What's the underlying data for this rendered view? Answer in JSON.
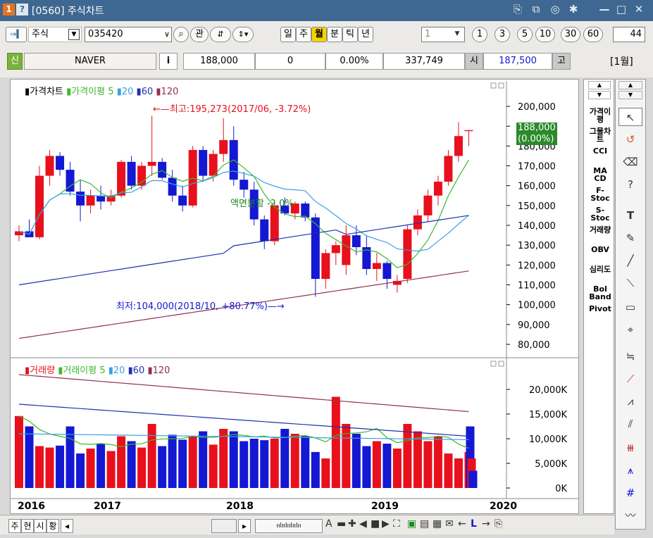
{
  "titlebar": {
    "num": "1",
    "help": "?",
    "title": "[0560] 주식차트",
    "icons": [
      "pin-icon",
      "copy-icon",
      "camera-icon",
      "settings-icon",
      "minimize-icon",
      "maximize-icon",
      "close-icon"
    ],
    "glyphs": [
      "⎘",
      "⧉",
      "◎",
      "✱",
      "—",
      "□",
      "✕"
    ]
  },
  "toolbar": {
    "arrow": "⇒▍",
    "market": "주식",
    "code": "035420",
    "rel": "관",
    "periods": [
      "일",
      "주",
      "월",
      "분",
      "틱",
      "년"
    ],
    "active_period": "월",
    "count": "1",
    "nums": [
      "1",
      "3",
      "5",
      "10",
      "30",
      "60"
    ],
    "right_value": "44",
    "sin": "신",
    "name": "NAVER",
    "info": "i",
    "price": "188,000",
    "change": "0",
    "rate": "0.00%",
    "volume": "337,749",
    "open_label": "시",
    "open_value": "187,500",
    "high_label": "고",
    "interval": "[1월]"
  },
  "price_chart": {
    "legend": [
      "가격차트",
      "가격이평",
      "5",
      "20",
      "60",
      "120"
    ],
    "yticks": [
      "200,000",
      "190,000",
      "180,000",
      "170,000",
      "160,000",
      "150,000",
      "140,000",
      "130,000",
      "120,000",
      "110,000",
      "100,000",
      "90,000",
      "80,000"
    ],
    "current_price": "188,000",
    "current_rate": "(0.00%)",
    "high_note": "←—최고:195,273(2017/06, -3.72%)",
    "low_note": "최저:104,000(2018/10, +80.77%)—→",
    "split_note": "액면분할 -2.0%"
  },
  "volume_chart": {
    "legend": [
      "거래량",
      "거래이평",
      "5",
      "20",
      "60",
      "120"
    ],
    "yticks": [
      "20,000K",
      "15,000K",
      "10,000K",
      "5,000K",
      "0K"
    ]
  },
  "xaxis": [
    "2016",
    "2017",
    "2018",
    "2019",
    "2020"
  ],
  "indicators": [
    "가격이평",
    "그물차트",
    "CCI",
    "MA CD",
    "F-Stoc",
    "S-Stoc",
    "거래량",
    "OBV",
    "심리도",
    "Bol Band",
    "Pivot"
  ],
  "colors": {
    "up": "#e8101c",
    "down": "#1418d2",
    "ma5": "#3cb82a",
    "ma20": "#38a0e8",
    "ma60": "#2030b0",
    "ma120": "#903050",
    "title": "#3e6891"
  },
  "chart_data": {
    "type": "candlestick",
    "interval": "monthly",
    "y_unit": "KRW",
    "ohlc": [
      [
        135000,
        140000,
        132000,
        137000
      ],
      [
        137000,
        143000,
        134000,
        134000
      ],
      [
        134000,
        170000,
        133000,
        165000
      ],
      [
        165000,
        178000,
        160000,
        175000
      ],
      [
        175000,
        177000,
        165000,
        168000
      ],
      [
        168000,
        172000,
        155000,
        157000
      ],
      [
        157000,
        163000,
        142000,
        150000
      ],
      [
        150000,
        158000,
        146000,
        155000
      ],
      [
        155000,
        160000,
        148000,
        152000
      ],
      [
        152000,
        158000,
        150000,
        155000
      ],
      [
        155000,
        173000,
        154000,
        172000
      ],
      [
        172000,
        175000,
        158000,
        160000
      ],
      [
        160000,
        172000,
        158000,
        170000
      ],
      [
        170000,
        195273,
        165000,
        172000
      ],
      [
        172000,
        174000,
        163000,
        164000
      ],
      [
        164000,
        168000,
        152000,
        155000
      ],
      [
        155000,
        160000,
        147000,
        150000
      ],
      [
        150000,
        180000,
        149000,
        178000
      ],
      [
        178000,
        180000,
        162000,
        165000
      ],
      [
        165000,
        178000,
        162000,
        176000
      ],
      [
        176000,
        194000,
        172000,
        183000
      ],
      [
        183000,
        190000,
        160000,
        163000
      ],
      [
        163000,
        167000,
        154000,
        158000
      ],
      [
        158000,
        162000,
        140000,
        143000
      ],
      [
        143000,
        145000,
        128000,
        132000
      ],
      [
        132000,
        152000,
        130000,
        150000
      ],
      [
        150000,
        154000,
        145000,
        146000
      ],
      [
        146000,
        152000,
        143000,
        151000
      ],
      [
        151000,
        152000,
        142000,
        144000
      ],
      [
        144000,
        146000,
        104000,
        113000
      ],
      [
        113000,
        128000,
        108000,
        126000
      ],
      [
        126000,
        132000,
        120000,
        130000
      ],
      [
        120000,
        140000,
        115000,
        135000
      ],
      [
        135000,
        140000,
        125000,
        129000
      ],
      [
        129000,
        135000,
        115000,
        118000
      ],
      [
        118000,
        126000,
        112000,
        121000
      ],
      [
        121000,
        122000,
        108000,
        113000
      ],
      [
        110000,
        115000,
        106000,
        112000
      ],
      [
        113000,
        140000,
        111000,
        138000
      ],
      [
        138000,
        148000,
        135000,
        145000
      ],
      [
        145000,
        158000,
        142000,
        155000
      ],
      [
        155000,
        165000,
        150000,
        162000
      ],
      [
        162000,
        178000,
        160000,
        175000
      ],
      [
        175000,
        192000,
        172000,
        185000
      ],
      [
        187500,
        188000,
        180000,
        188000
      ]
    ],
    "volume_k": [
      14600,
      12500,
      8500,
      8200,
      8600,
      12500,
      7000,
      8000,
      9000,
      7500,
      10500,
      9500,
      8200,
      13000,
      8500,
      10800,
      9800,
      10500,
      11500,
      8800,
      12000,
      11500,
      9500,
      10000,
      9700,
      10000,
      12000,
      11000,
      10500,
      7300,
      6000,
      18500,
      13000,
      11000,
      8500,
      9500,
      9000,
      8000,
      13000,
      11500,
      9500,
      10500,
      7000,
      6000,
      7300,
      12500,
      6000,
      3500
    ]
  }
}
